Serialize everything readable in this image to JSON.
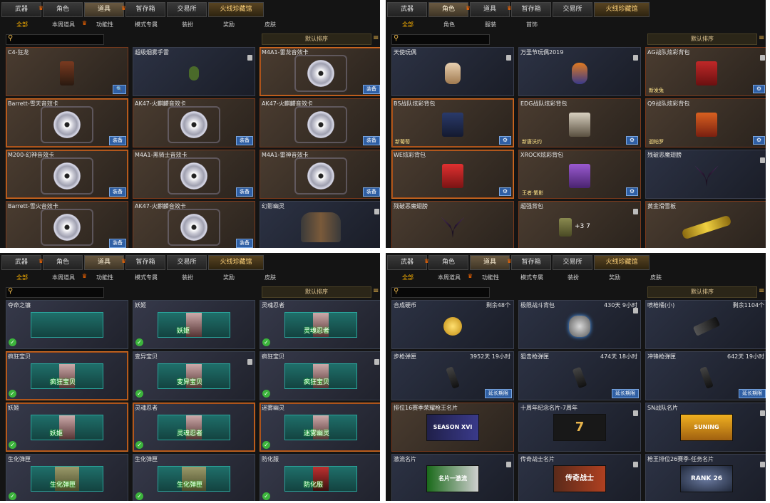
{
  "panels": [
    {
      "tabs": [
        "武器",
        "角色",
        "道具",
        "暂存箱",
        "交易所",
        "火线珍藏馆"
      ],
      "active_tab": 2,
      "subtabs": [
        "全部",
        "本周道具",
        "功能性",
        "模式专属",
        "装扮",
        "奖励",
        "皮肤"
      ],
      "sort_label": "默认排序",
      "items": [
        {
          "name": "C4-狂龙",
          "icon": "c4-bomb-icon",
          "button": "🔍"
        },
        {
          "name": "超级烟雾手雷",
          "icon": "grenade-icon"
        },
        {
          "name": "M4A1-雷龙音效卡",
          "icon": "sound-card-icon",
          "button": "装备"
        },
        {
          "name": "Barrett-雪天音效卡",
          "icon": "sound-card-icon",
          "button": "装备"
        },
        {
          "name": "AK47-火麒麟音效卡",
          "icon": "sound-card-icon",
          "button": "装备"
        },
        {
          "name": "AK47-火麒麟音效卡",
          "icon": "sound-card-icon",
          "button": "装备"
        },
        {
          "name": "M200-幻神音效卡",
          "icon": "sound-card-icon",
          "button": "装备"
        },
        {
          "name": "M4A1-黑骑士音效卡",
          "icon": "sound-card-icon",
          "button": "装备"
        },
        {
          "name": "M4A1-雷神音效卡",
          "icon": "sound-card-icon",
          "button": "装备"
        },
        {
          "name": "Barrett-雪火音效卡",
          "icon": "sound-card-icon",
          "button": "装备"
        },
        {
          "name": "AK47-火麒麟音效卡",
          "icon": "sound-card-icon",
          "button": "装备"
        },
        {
          "name": "幻影幽灵",
          "icon": "ghost-characters-icon"
        }
      ]
    },
    {
      "tabs": [
        "武器",
        "角色",
        "道具",
        "暂存箱",
        "交易所",
        "火线珍藏馆"
      ],
      "active_tab": 1,
      "subtabs": [
        "全部",
        "角色",
        "服装",
        "首饰"
      ],
      "sort_label": "默认排序",
      "items": [
        {
          "name": "天使玩偶",
          "icon": "angel-doll-icon"
        },
        {
          "name": "万圣节玩偶2019",
          "icon": "halloween-doll-icon"
        },
        {
          "name": "AG战队炫彩背包",
          "icon": "backpack-icon",
          "tag": "新发兔",
          "button": "⚙"
        },
        {
          "name": "BS战队炫彩背包",
          "icon": "backpack-icon",
          "tag": "新葡萄",
          "button": "⚙"
        },
        {
          "name": "EDG战队炫彩背包",
          "icon": "backpack-icon",
          "tag": "新唐沃约",
          "button": "⚙"
        },
        {
          "name": "Q9战队炫彩背包",
          "icon": "backpack-icon",
          "tag": "迦帕罗",
          "button": "⚙"
        },
        {
          "name": "WE炫彩背包",
          "icon": "backpack-icon",
          "tag": "",
          "button": "⚙"
        },
        {
          "name": "XROCK炫彩背包",
          "icon": "backpack-icon",
          "tag": "王者·繁影",
          "button": "⚙"
        },
        {
          "name": "残破恶魔翅膀",
          "icon": "demon-wings-icon"
        },
        {
          "name": "残破恶魔翅膀",
          "icon": "demon-wings-icon"
        },
        {
          "name": "超强背包",
          "icon": "backpack-plus-icon",
          "extra": "+3 7"
        },
        {
          "name": "黄金滑雪板",
          "icon": "gold-snowboard-icon"
        }
      ]
    },
    {
      "tabs": [
        "武器",
        "角色",
        "道具",
        "暂存箱",
        "交易所",
        "火线珍藏馆"
      ],
      "active_tab": 2,
      "subtabs": [
        "全部",
        "本周道具",
        "功能性",
        "模式专属",
        "装扮",
        "奖励",
        "皮肤"
      ],
      "sort_label": "默认排序",
      "items": [
        {
          "name": "夺命之镰",
          "icon": "scythe-icon"
        },
        {
          "name": "妖姬",
          "label": "妖姬",
          "icon": "character-portrait-icon"
        },
        {
          "name": "灵魂忍者",
          "label": "灵魂忍者",
          "icon": "character-portrait-icon"
        },
        {
          "name": "疯狂宝贝",
          "label": "疯狂宝贝",
          "icon": "character-portrait-icon"
        },
        {
          "name": "变异宝贝",
          "label": "变异宝贝",
          "icon": "character-portrait-icon"
        },
        {
          "name": "疯狂宝贝",
          "label": "疯狂宝贝",
          "icon": "character-portrait-icon"
        },
        {
          "name": "妖姬",
          "label": "妖姬",
          "icon": "character-portrait-icon"
        },
        {
          "name": "灵魂忍者",
          "label": "灵魂忍者",
          "icon": "character-portrait-icon"
        },
        {
          "name": "迷雾幽灵",
          "label": "迷雾幽灵",
          "icon": "character-portrait-icon"
        },
        {
          "name": "生化弹匣",
          "label": "生化弹匣",
          "icon": "ammo-box-icon"
        },
        {
          "name": "生化弹匣",
          "label": "生化弹匣",
          "icon": "ammo-box-icon"
        },
        {
          "name": "防化服",
          "label": "防化服",
          "icon": "hazmat-suit-icon"
        }
      ]
    },
    {
      "tabs": [
        "武器",
        "角色",
        "道具",
        "暂存箱",
        "交易所",
        "火线珍藏馆"
      ],
      "active_tab": 2,
      "subtabs": [
        "全部",
        "本周道具",
        "功能性",
        "模式专属",
        "装扮",
        "奖励",
        "皮肤"
      ],
      "sort_label": "默认排序",
      "items": [
        {
          "name": "合成硬币",
          "meta": "剩余48个",
          "icon": "gold-coin-icon"
        },
        {
          "name": "极限战斗背包",
          "meta": "430天 9小时",
          "icon": "combat-pack-icon"
        },
        {
          "name": "喷枪桶(小)",
          "meta": "剩余1104个",
          "icon": "spray-gun-icon"
        },
        {
          "name": "步枪弹匣",
          "meta": "3952天 19小时",
          "icon": "magazine-icon",
          "button": "延长期限"
        },
        {
          "name": "狙击枪弹匣",
          "meta": "474天 18小时",
          "icon": "magazine-icon",
          "button": "延长期限"
        },
        {
          "name": "冲锋枪弹匣",
          "meta": "642天 19小时",
          "icon": "magazine-icon",
          "button": "延长期限"
        },
        {
          "name": "排位16赛季荣耀枪王名片",
          "icon": "season-card-icon",
          "plate": "SEASON XVI"
        },
        {
          "name": "十周年纪念名片-7周年",
          "icon": "anniversary-card-icon",
          "plate": "7"
        },
        {
          "name": "SN战队名片",
          "icon": "team-card-icon",
          "plate": "SUNING"
        },
        {
          "name": "激流名片",
          "icon": "torrent-card-icon",
          "plate": "名片一激流"
        },
        {
          "name": "传奇战士名片",
          "icon": "legend-card-icon",
          "plate": "传奇战士"
        },
        {
          "name": "枪王排位26赛季-任务名片",
          "icon": "rank-card-icon",
          "plate": "RANK 26"
        }
      ]
    }
  ]
}
